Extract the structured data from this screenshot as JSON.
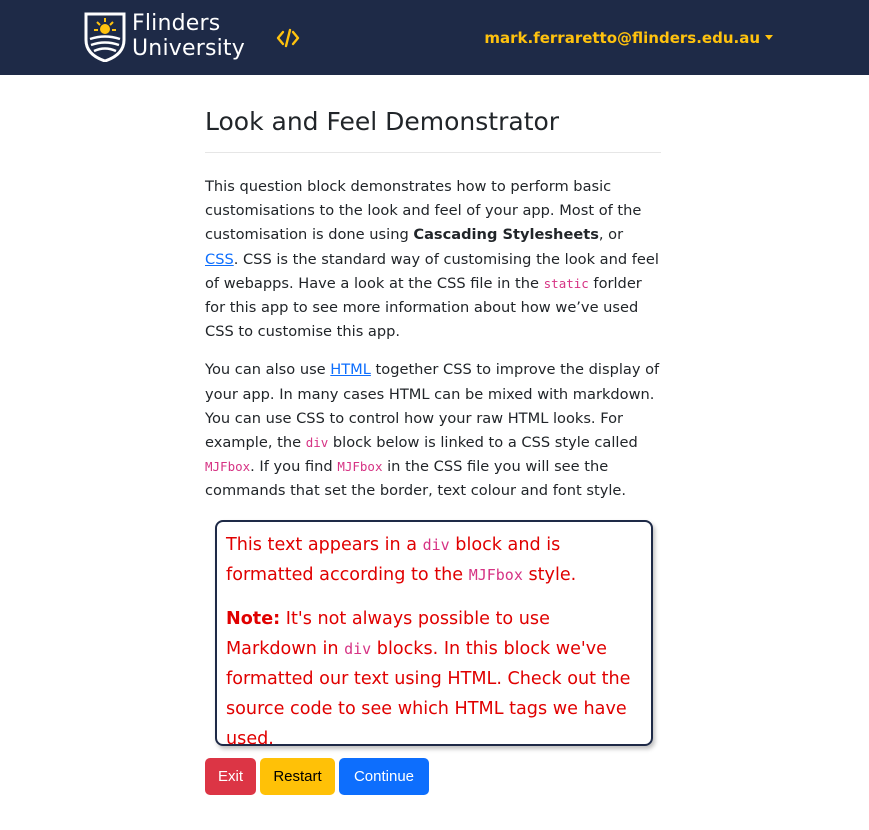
{
  "navbar": {
    "brand_line1": "Flinders",
    "brand_line2": "University",
    "user_email": "mark.ferraretto@flinders.edu.au",
    "accent_color": "#ffc20e",
    "background_color": "#1e2a47",
    "icons": [
      "flinders-logo-icon",
      "code-icon",
      "caret-down-icon"
    ]
  },
  "main": {
    "title": "Look and Feel Demonstrator",
    "para1": {
      "t1": "This question block demonstrates how to perform basic customisations to the look and feel of your app. Most of the customisation is done using ",
      "bold": "Cascading Stylesheets",
      "t2": ", or ",
      "link": "CSS",
      "t3": ". CSS is the standard way of customising the look and feel of webapps. Have a look at the CSS file in the ",
      "code": "static",
      "t4": " forlder for this app to see more information about how we’ve used CSS to customise this app."
    },
    "para2": {
      "t1": "You can also use ",
      "link": "HTML",
      "t2": " together CSS to improve the display of your app. In many cases HTML can be mixed with markdown. You can use CSS to control how your raw HTML looks. For example, the ",
      "code1": "div",
      "t3": " block below is linked to a CSS style called ",
      "code2": "MJFbox",
      "t4": ". If you find ",
      "code3": "MJFbox",
      "t5": " in the CSS file you will see the commands that set the border, text colour and font style."
    }
  },
  "box": {
    "p1": {
      "t1": "This text appears in a ",
      "code1": "div",
      "t2": " block and is formatted according to the ",
      "code2": "MJFbox",
      "t3": " style."
    },
    "p2": {
      "bold": "Note:",
      "t1": " It's not always possible to use Markdown in ",
      "code": "div",
      "t2": " blocks. In this block we've formatted our text using HTML. Check out the source code to see which HTML tags we have used."
    },
    "text_color": "#e00000"
  },
  "buttons": {
    "exit": "Exit",
    "restart": "Restart",
    "continue": "Continue",
    "exit_color": "#dc3545",
    "restart_color": "#ffc107",
    "continue_color": "#0d6efd"
  }
}
